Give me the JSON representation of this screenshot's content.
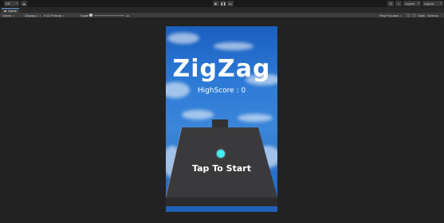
{
  "toolbar": {
    "account_label": "DR",
    "play_icon": "play-icon",
    "pause_icon": "pause-icon",
    "step_icon": "step-icon",
    "layers_label": "Layers",
    "layout_label": "Layout"
  },
  "tab": {
    "label": "Game"
  },
  "gamebar": {
    "display_mode": "Game",
    "display": "Display 1",
    "resolution": "9:16 Portrait",
    "scale_label": "Scale",
    "scale_value": "1x",
    "play_focused": "Play Focused",
    "stats": "Stats",
    "gizmos": "Gizmos"
  },
  "game": {
    "title": "ZigZag",
    "highscore": "HighScore : 0",
    "start": "Tap To Start",
    "ball_color": "#3ff0f0",
    "sky_color": "#2d7ad6",
    "platform_color": "#3a3a3c"
  }
}
